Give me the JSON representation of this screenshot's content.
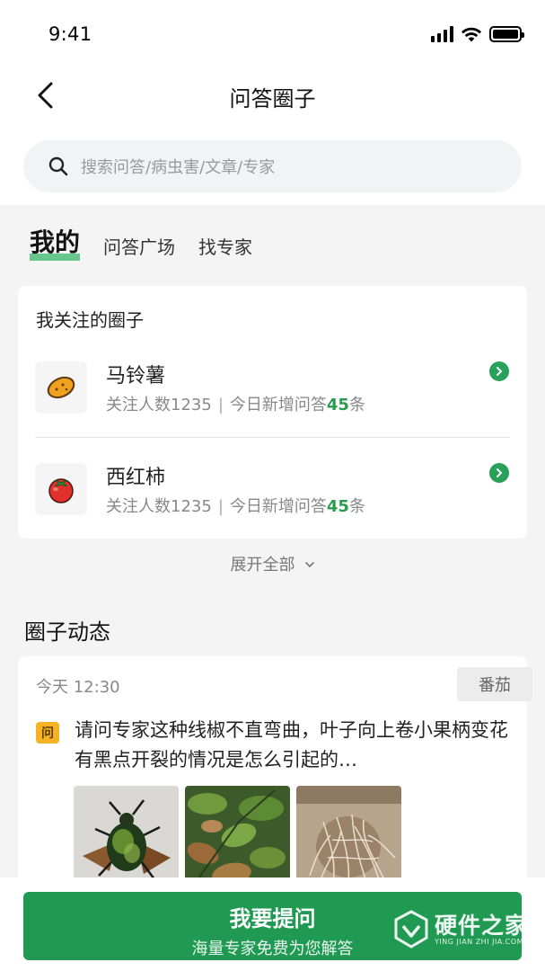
{
  "status_bar": {
    "time": "9:41"
  },
  "nav": {
    "title": "问答圈子"
  },
  "search": {
    "placeholder": "搜索问答/病虫害/文章/专家"
  },
  "tabs": [
    {
      "label": "我的",
      "active": true
    },
    {
      "label": "问答广场",
      "active": false
    },
    {
      "label": "找专家",
      "active": false
    }
  ],
  "followed": {
    "title": "我关注的圈子",
    "items": [
      {
        "name": "马铃薯",
        "followers_label": "关注人数1235",
        "separator": "|",
        "new_prefix": "今日新增问答",
        "new_count": "45",
        "new_suffix": "条",
        "icon": "potato-icon"
      },
      {
        "name": "西红柿",
        "followers_label": "关注人数1235",
        "separator": "|",
        "new_prefix": "今日新增问答",
        "new_count": "45",
        "new_suffix": "条",
        "icon": "tomato-icon"
      }
    ]
  },
  "expand_label": "展开全部",
  "feed": {
    "title": "圈子动态",
    "post": {
      "time": "今天 12:30",
      "tag": "番茄",
      "badge": "问",
      "question": "请问专家这种线椒不直弯曲，叶子向上卷小果柄变花有黑点开裂的情况是怎么引起的…",
      "photos": [
        "beetle-photo",
        "leaves-photo",
        "roots-photo"
      ]
    }
  },
  "ask_button": {
    "label": "我要提问",
    "sublabel": "海量专家免费为您解答"
  },
  "watermark": {
    "cn": "硬件之家",
    "en": "YING JIAN ZHI JIA.COM"
  },
  "colors": {
    "accent": "#209a52",
    "highlight": "#38b76a",
    "badge": "#f5b323"
  }
}
